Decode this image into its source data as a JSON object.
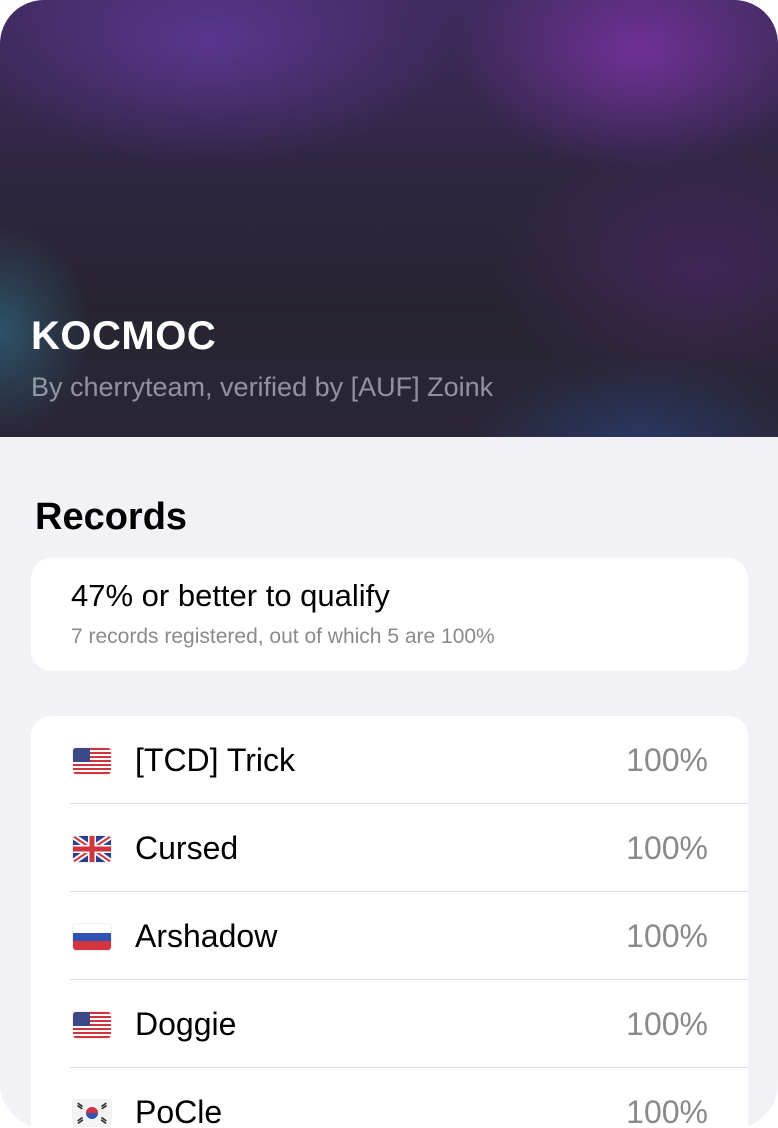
{
  "header": {
    "title": "KOCMOC",
    "subtitle": "By cherryteam, verified by [AUF] Zoink"
  },
  "records": {
    "section_title": "Records",
    "qualify": {
      "main": "47% or better to qualify",
      "sub": "7 records registered, out of which 5 are 100%"
    },
    "items": [
      {
        "flag": "us-flag-icon",
        "name": "[TCD] Trick",
        "percent": "100%"
      },
      {
        "flag": "uk-flag-icon",
        "name": "Cursed",
        "percent": "100%"
      },
      {
        "flag": "ru-flag-icon",
        "name": "Arshadow",
        "percent": "100%"
      },
      {
        "flag": "us-flag-icon",
        "name": "Doggie",
        "percent": "100%"
      },
      {
        "flag": "kr-flag-icon",
        "name": "PoCle",
        "percent": "100%"
      }
    ]
  },
  "colors": {
    "background": "#f2f1f6",
    "card": "#ffffff",
    "secondary_text": "#8a8a8e",
    "hero_dark": "#272430",
    "hero_purple": "#5a3585"
  }
}
